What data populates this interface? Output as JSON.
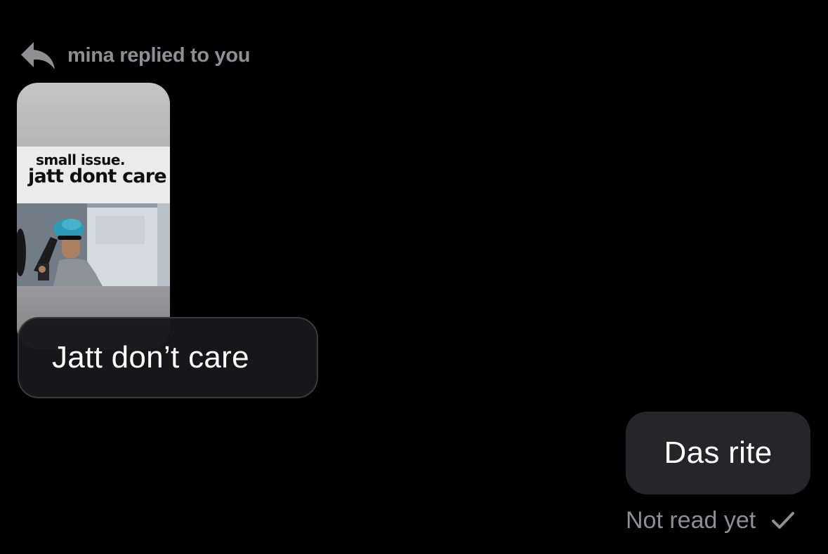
{
  "reply_header": {
    "icon": "reply-arrow-icon",
    "text": "mina replied to you"
  },
  "reply_preview": {
    "meme_small_text": "small issue.",
    "meme_big_text": "jatt dont care"
  },
  "messages": [
    {
      "direction": "incoming",
      "text": "Jatt don’t care"
    },
    {
      "direction": "outgoing",
      "text": "Das rite"
    }
  ],
  "receipt": {
    "text": "Not read yet",
    "icon": "checkmark-icon"
  },
  "colors": {
    "background": "#000000",
    "secondary_text": "#8e8e93",
    "bubble": "#262628",
    "bubble_border": "#3a3a3c"
  }
}
